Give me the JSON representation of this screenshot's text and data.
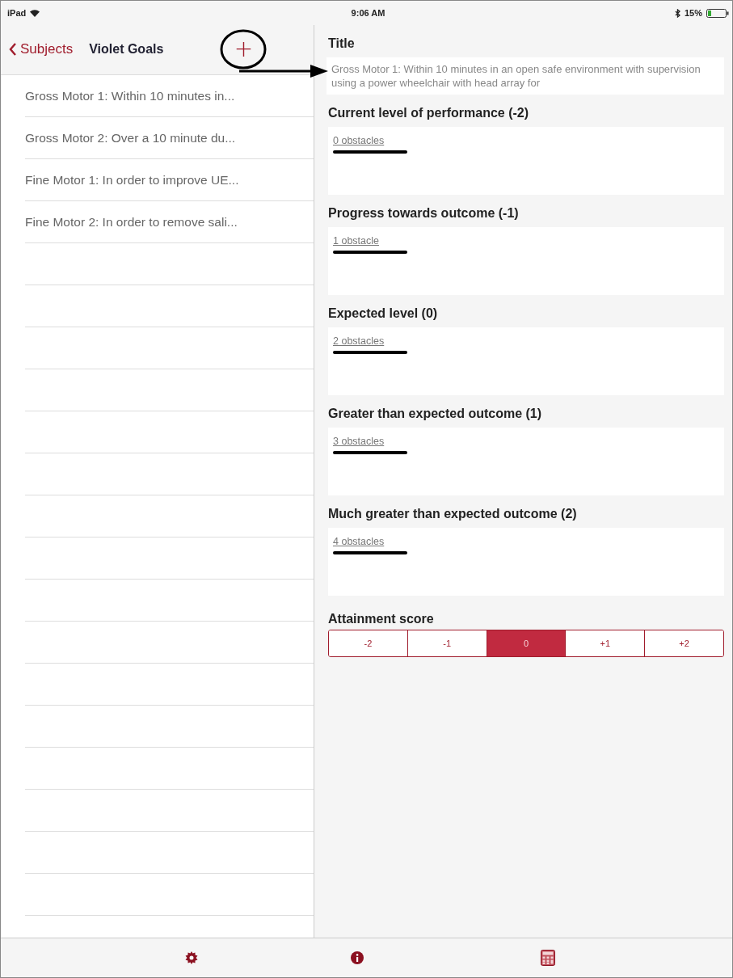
{
  "status_bar": {
    "device": "iPad",
    "time": "9:06 AM",
    "battery": "15%"
  },
  "nav": {
    "back": "Subjects",
    "title": "Violet Goals",
    "add": "+"
  },
  "goals": [
    {
      "label": "Gross Motor 1: Within 10 minutes in..."
    },
    {
      "label": "Gross Motor 2: Over a 10 minute du..."
    },
    {
      "label": "Fine Motor 1: In order to improve UE..."
    },
    {
      "label": "Fine Motor 2: In order to remove sali..."
    }
  ],
  "title_field": {
    "label": "Title",
    "value": "Gross Motor 1: Within 10 minutes in an open safe environment with supervision using a power wheelchair with head array for"
  },
  "levels": [
    {
      "heading": "Current level of performance (-2)",
      "link": "0 obstacles"
    },
    {
      "heading": "Progress towards outcome (-1)",
      "link": "1 obstacle"
    },
    {
      "heading": "Expected level (0)",
      "link": "2 obstacles"
    },
    {
      "heading": "Greater than expected outcome (1)",
      "link": "3 obstacles"
    },
    {
      "heading": "Much greater than expected outcome (2)",
      "link": "4 obstacles"
    }
  ],
  "attainment": {
    "label": "Attainment score",
    "options": [
      {
        "label": "-2",
        "selected": false
      },
      {
        "label": "-1",
        "selected": false
      },
      {
        "label": "0",
        "selected": true
      },
      {
        "label": "+1",
        "selected": false
      },
      {
        "label": "+2",
        "selected": false
      }
    ]
  },
  "tab_bar": [
    {
      "kind": "settings"
    },
    {
      "kind": "info"
    },
    {
      "kind": "calculator"
    }
  ]
}
